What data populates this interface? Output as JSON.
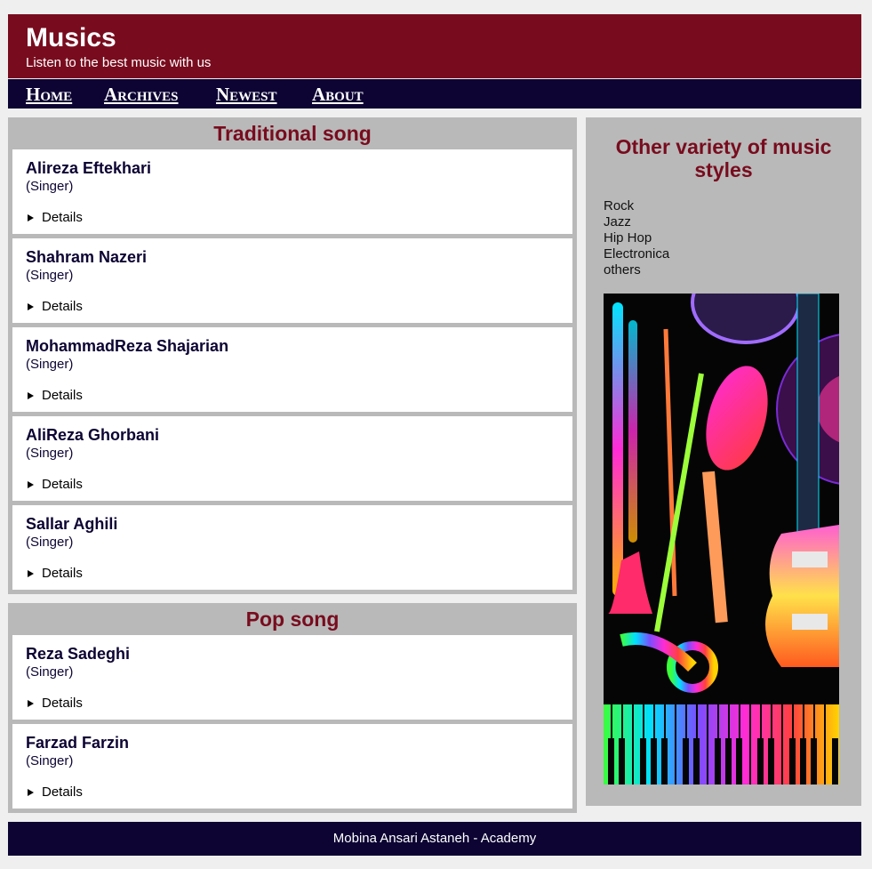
{
  "header": {
    "title": "Musics",
    "subtitle": "Listen to the best music with us"
  },
  "nav": {
    "items": [
      "Home",
      "Archives",
      "Newest",
      "About"
    ]
  },
  "traditional": {
    "title": "Traditional song",
    "artists": [
      {
        "name": "Alireza Eftekhari",
        "role": "(Singer)",
        "details": "Details"
      },
      {
        "name": "Shahram Nazeri",
        "role": "(Singer)",
        "details": "Details"
      },
      {
        "name": "MohammadReza Shajarian",
        "role": "(Singer)",
        "details": "Details"
      },
      {
        "name": "AliReza Ghorbani",
        "role": "(Singer)",
        "details": "Details"
      },
      {
        "name": "Sallar Aghili",
        "role": "(Singer)",
        "details": "Details"
      }
    ]
  },
  "pop": {
    "title": "Pop song",
    "artists": [
      {
        "name": "Reza Sadeghi",
        "role": "(Singer)",
        "details": "Details"
      },
      {
        "name": "Farzad Farzin",
        "role": "(Singer)",
        "details": "Details"
      }
    ]
  },
  "aside": {
    "title": "Other variety of music styles",
    "styles": [
      "Rock",
      "Jazz",
      "Hip Hop",
      "Electronica",
      "others"
    ]
  },
  "footer": {
    "text": "Mobina Ansari Astaneh - Academy"
  },
  "colors": {
    "brand": "#780c1e",
    "nav": "#0d0433",
    "panel": "#b9b9b9"
  }
}
